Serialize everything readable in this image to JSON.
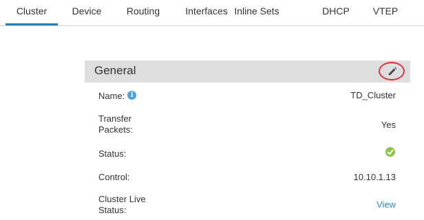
{
  "tabs": [
    {
      "label": "Cluster",
      "active": true
    },
    {
      "label": "Device",
      "active": false
    },
    {
      "label": "Routing",
      "active": false
    },
    {
      "label": "Interfaces",
      "active": false
    },
    {
      "label": "Inline Sets",
      "active": false
    },
    {
      "label": "DHCP",
      "active": false
    },
    {
      "label": "VTEP",
      "active": false
    }
  ],
  "general": {
    "title": "General",
    "edit_icon": "pencil-icon",
    "highlight_color": "#d9363e",
    "rows": {
      "name": {
        "label": "Name:",
        "value": "TD_Cluster",
        "info_icon": "i"
      },
      "transfer_packets": {
        "label_line1": "Transfer",
        "label_line2": "Packets:",
        "value": "Yes"
      },
      "status": {
        "label": "Status:",
        "icon": "check-circle-icon"
      },
      "control": {
        "label": "Control:",
        "value": "10.10.1.13"
      },
      "cluster_live_status": {
        "label_line1": "Cluster Live",
        "label_line2": "Status:",
        "value": "View"
      }
    }
  },
  "colors": {
    "accent": "#1a7fb5",
    "link": "#2a8ccb",
    "status_ok": "#8bc34a",
    "info": "#4aa3df"
  }
}
